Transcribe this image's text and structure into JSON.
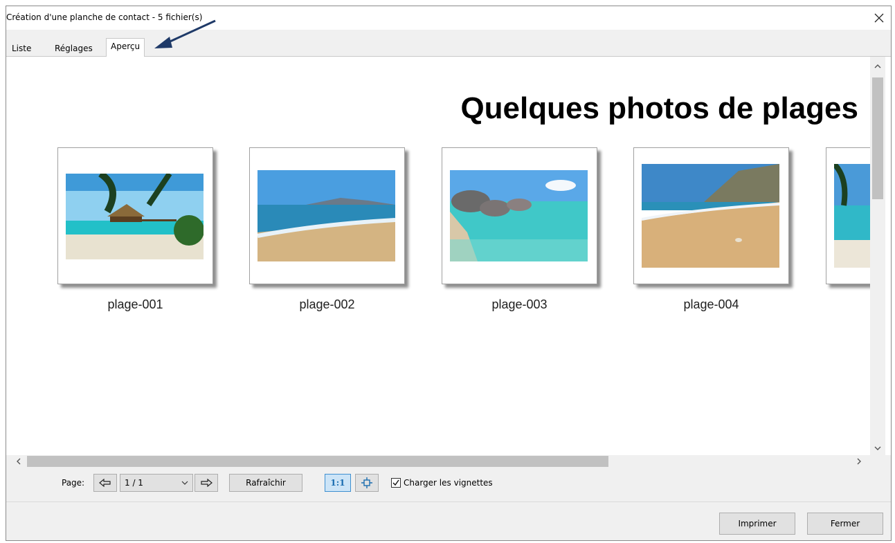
{
  "window": {
    "title": "Création d'une planche de contact - 5 fichier(s)"
  },
  "tabs": [
    {
      "label": "Liste",
      "active": false
    },
    {
      "label": "Réglages",
      "active": false
    },
    {
      "label": "Aperçu",
      "active": true
    }
  ],
  "preview": {
    "heading": "Quelques photos de plages",
    "thumbnails": [
      {
        "label": "plage-001"
      },
      {
        "label": "plage-002"
      },
      {
        "label": "plage-003"
      },
      {
        "label": "plage-004"
      },
      {
        "label": ""
      }
    ]
  },
  "toolbar": {
    "page_label": "Page:",
    "page_value": "1 / 1",
    "refresh_label": "Rafraîchir",
    "zoom_1to1_label": "1:1",
    "load_thumbnails_label": "Charger les vignettes",
    "load_thumbnails_checked": true
  },
  "footer": {
    "print_label": "Imprimer",
    "close_label": "Fermer"
  },
  "colors": {
    "accent_blue": "#1f3a68",
    "zoom_icon": "#1a6db0"
  }
}
